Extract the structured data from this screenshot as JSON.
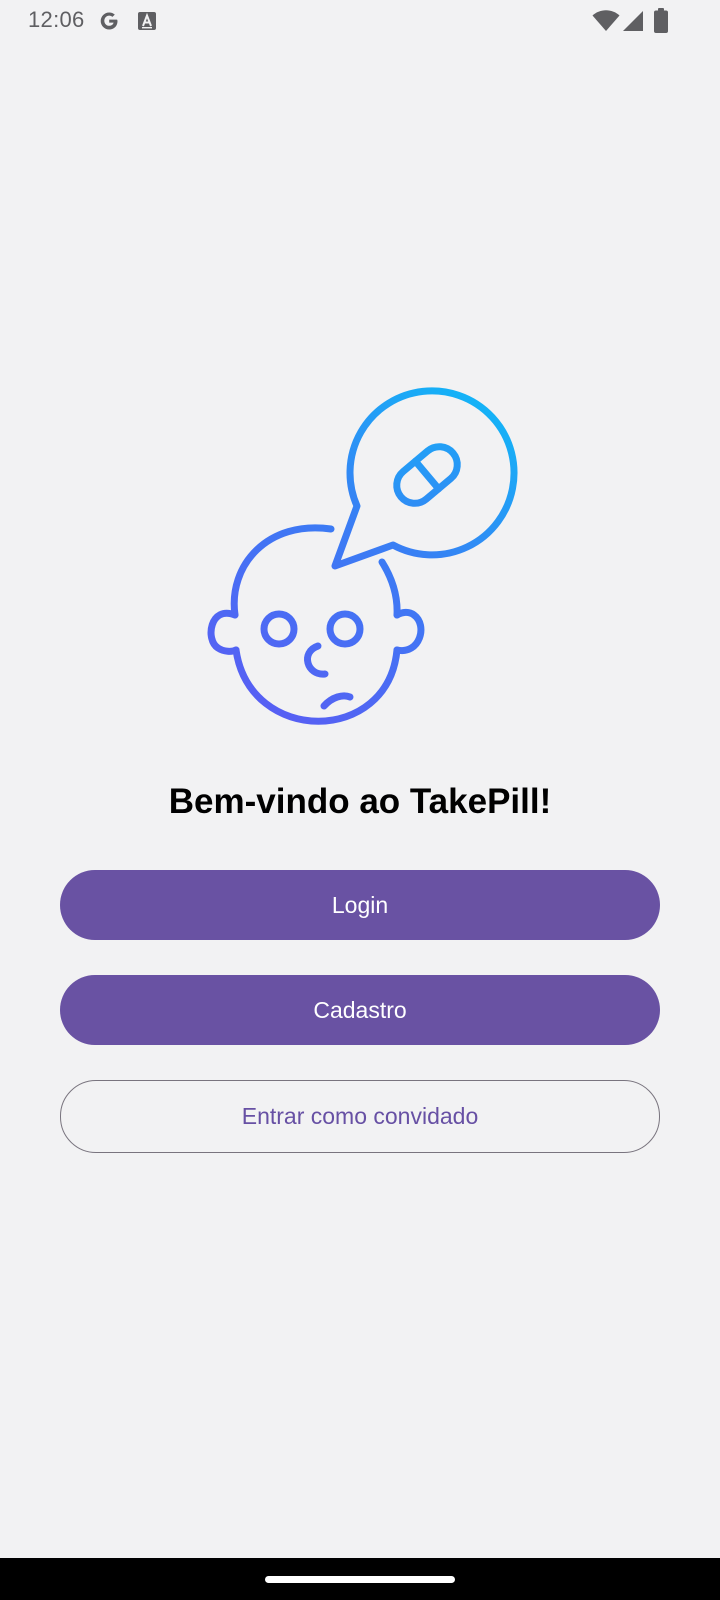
{
  "status_bar": {
    "time": "12:06",
    "icons": [
      "google-icon",
      "accessibility-text-icon",
      "wifi-icon",
      "cellular-signal-icon",
      "battery-icon"
    ],
    "icon_color": "#5f5f62"
  },
  "welcome": {
    "title": "Bem-vindo ao TakePill!",
    "illustration": "baby-thinking-pill-icon",
    "gradient_colors": [
      "#5a5cf3",
      "#12b6f7"
    ]
  },
  "actions": {
    "login_label": "Login",
    "signup_label": "Cadastro",
    "guest_label": "Entrar como convidado"
  },
  "theme": {
    "primary": "#6952a3",
    "primary_text": "#6750a4",
    "outline": "#79747e",
    "background": "#f2f2f3"
  },
  "navigation_bar": {
    "handle": "gesture-handle"
  }
}
